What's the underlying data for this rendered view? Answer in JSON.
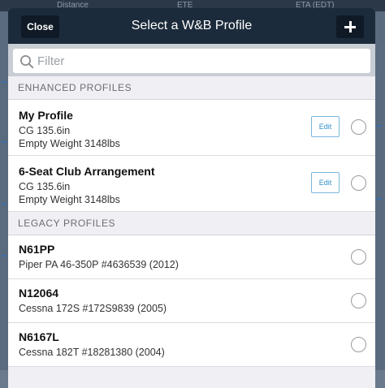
{
  "background": {
    "columns": [
      "Distance",
      "ETE",
      "ETA (EDT)"
    ]
  },
  "modal": {
    "title": "Select a W&B Profile",
    "close_label": "Close",
    "add_icon": "plus-icon"
  },
  "search": {
    "placeholder": "Filter",
    "value": ""
  },
  "sections": {
    "enhanced": {
      "header": "ENHANCED PROFILES",
      "items": [
        {
          "title": "My Profile",
          "line1": "CG 135.6in",
          "line2": "Empty Weight 3148lbs",
          "edit_label": "Edit"
        },
        {
          "title": "6-Seat Club Arrangement",
          "line1": "CG 135.6in",
          "line2": "Empty Weight 3148lbs",
          "edit_label": "Edit"
        }
      ]
    },
    "legacy": {
      "header": "LEGACY PROFILES",
      "items": [
        {
          "title": "N61PP",
          "line1": "Piper PA 46-350P #4636539 (2012)"
        },
        {
          "title": "N12064",
          "line1": "Cessna 172S #172S9839 (2005)"
        },
        {
          "title": "N6167L",
          "line1": "Cessna 182T #18281380 (2004)"
        }
      ]
    }
  },
  "colors": {
    "header_bg": "#1c2b3b",
    "accent": "#2f8fd0",
    "list_bg": "#efeff4"
  }
}
